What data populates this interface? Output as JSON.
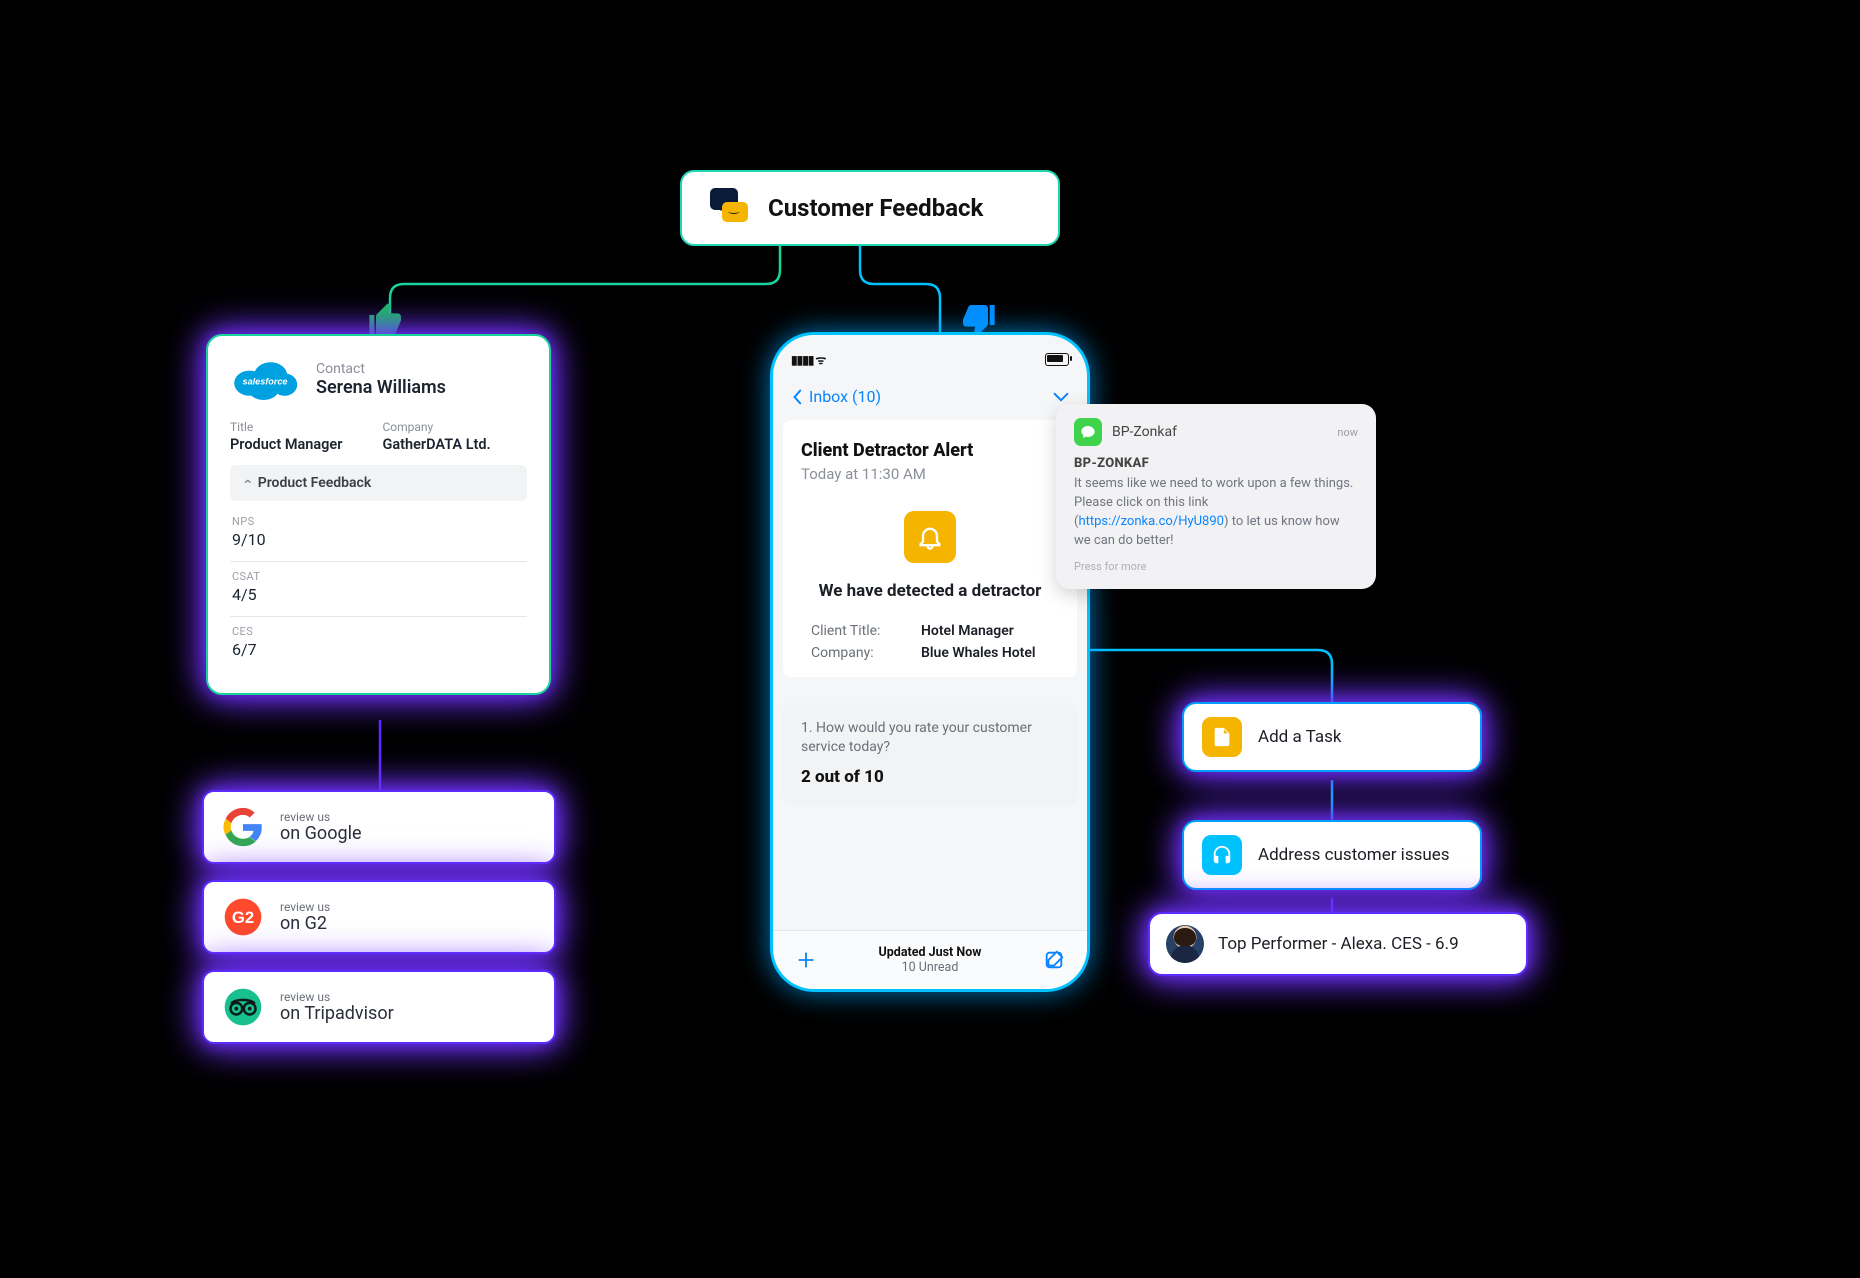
{
  "pill": {
    "title": "Customer Feedback"
  },
  "salesforce": {
    "brand": "salesforce",
    "contact_label": "Contact",
    "contact_name": "Serena Williams",
    "title_label": "Title",
    "title_value": "Product Manager",
    "company_label": "Company",
    "company_value": "GatherDATA Ltd.",
    "section": "Product Feedback",
    "metrics": [
      {
        "k": "NPS",
        "v": "9/10"
      },
      {
        "k": "CSAT",
        "v": "4/5"
      },
      {
        "k": "CES",
        "v": "6/7"
      }
    ]
  },
  "reviews": [
    {
      "small": "review us",
      "big": "on Google",
      "brand": "google"
    },
    {
      "small": "review us",
      "big": "on G2",
      "brand": "g2"
    },
    {
      "small": "review us",
      "big": "on Tripadvisor",
      "brand": "tripadvisor"
    }
  ],
  "phone": {
    "inbox_label": "Inbox (10)",
    "alert_title": "Client Detractor Alert",
    "alert_time": "Today at 11:30 AM",
    "detect_heading": "We have detected a detractor",
    "client_title_label": "Client Title:",
    "client_title_value": "Hotel Manager",
    "company_label": "Company:",
    "company_value": "Blue Whales Hotel",
    "question": "1.   How would you rate your customer service today?",
    "answer": "2 out of 10",
    "updated": "Updated Just Now",
    "unread": "10 Unread"
  },
  "notification": {
    "app": "BP-Zonkaf",
    "time": "now",
    "title": "BP-ZONKAF",
    "body_before": "It seems like we need to work upon a few things. Please click on this link (",
    "link": "https://zonka.co/HyU890",
    "body_after": ") to let us know how we can do better!",
    "press": "Press for more"
  },
  "actions": {
    "task": "Add a Task",
    "issues": "Address customer issues",
    "performer": "Top Performer - Alexa. CES - 6.9"
  }
}
